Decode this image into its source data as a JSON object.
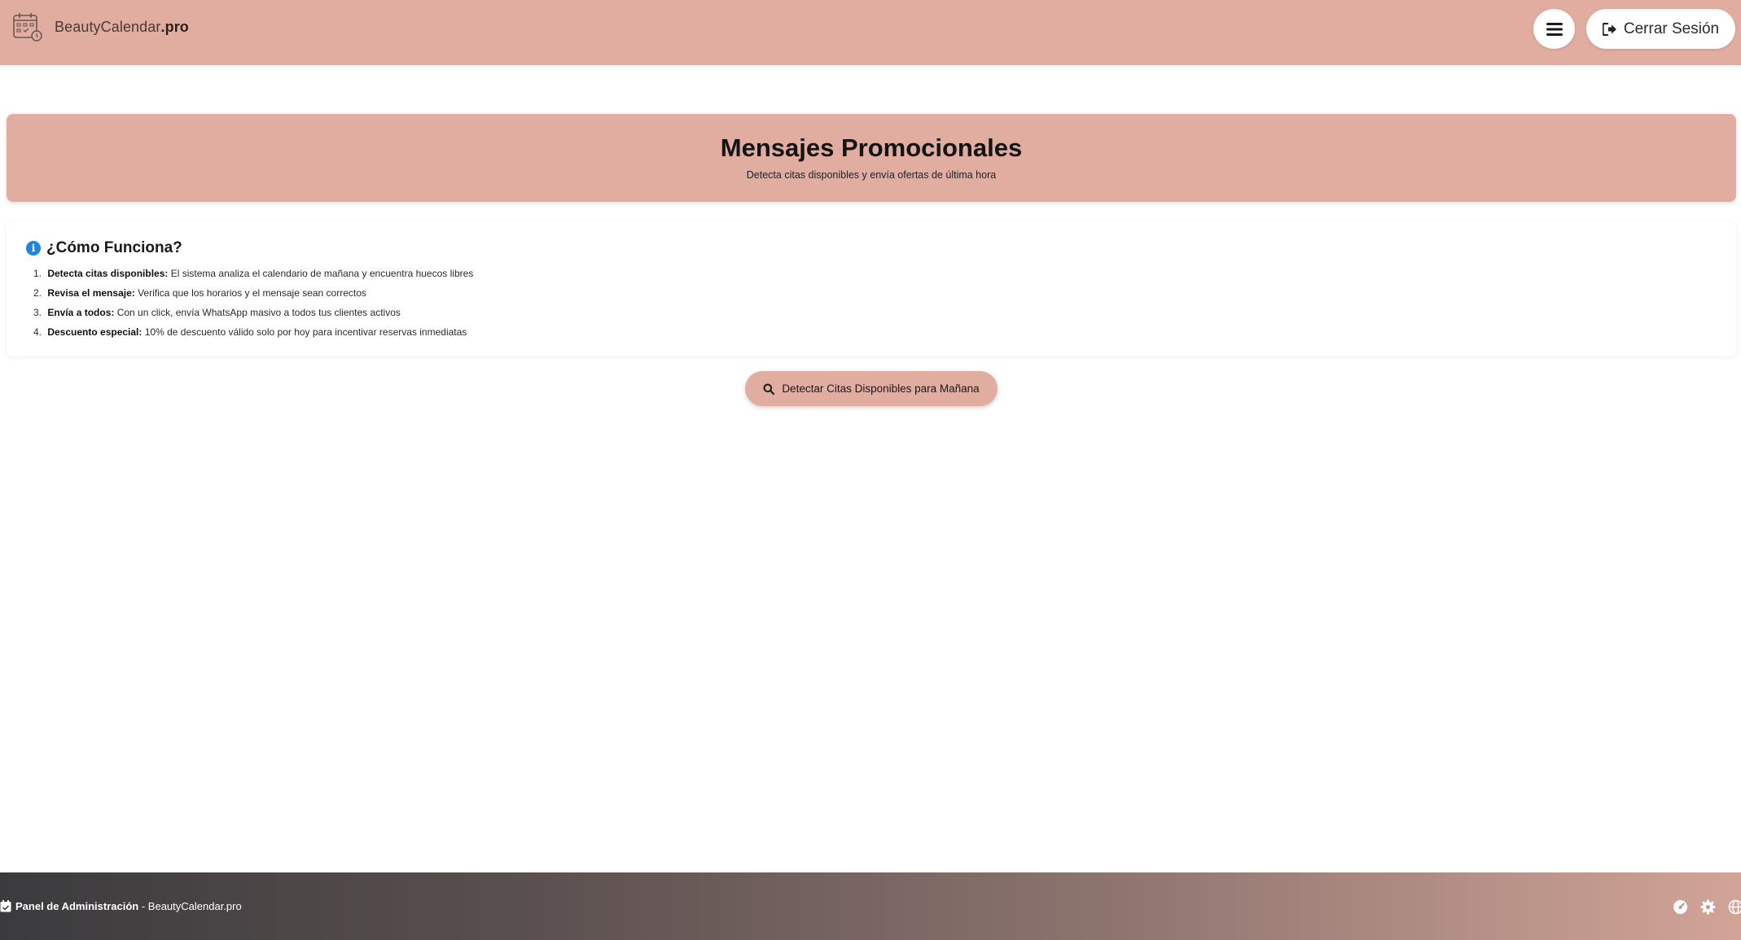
{
  "header": {
    "brand_name": "BeautyCalendar",
    "brand_suffix": ".pro",
    "menu_icon": "hamburger-menu-icon",
    "logout_label": "Cerrar Sesión",
    "logout_icon": "sign-out-icon"
  },
  "hero": {
    "title": "Mensajes Promocionales",
    "subtitle": "Detecta citas disponibles y envía ofertas de última hora"
  },
  "how_it_works": {
    "title": "¿Cómo Funciona?",
    "icon": "info-circle-icon",
    "steps": [
      {
        "num": "1.",
        "label": "Detecta citas disponibles:",
        "text": "El sistema analiza el calendario de mañana y encuentra huecos libres"
      },
      {
        "num": "2.",
        "label": "Revisa el mensaje:",
        "text": "Verifica que los horarios y el mensaje sean correctos"
      },
      {
        "num": "3.",
        "label": "Envía a todos:",
        "text": "Con un click, envía WhatsApp masivo a todos tus clientes activos"
      },
      {
        "num": "4.",
        "label": "Descuento especial:",
        "text": "10% de descuento válido solo por hoy para incentivar reservas inmediatas"
      }
    ]
  },
  "action": {
    "detect_label": "Detectar Citas Disponibles para Mañana",
    "detect_icon": "search-icon"
  },
  "footer": {
    "panel_label": "Panel de Administración",
    "separator": " - ",
    "site": "BeautyCalendar.pro",
    "icons": [
      "dashboard-icon",
      "gear-icon",
      "globe-icon"
    ]
  },
  "colors": {
    "accent": "#e0ada0",
    "info_blue": "#1e88d6",
    "footer_dark": "#3b3b3d"
  }
}
